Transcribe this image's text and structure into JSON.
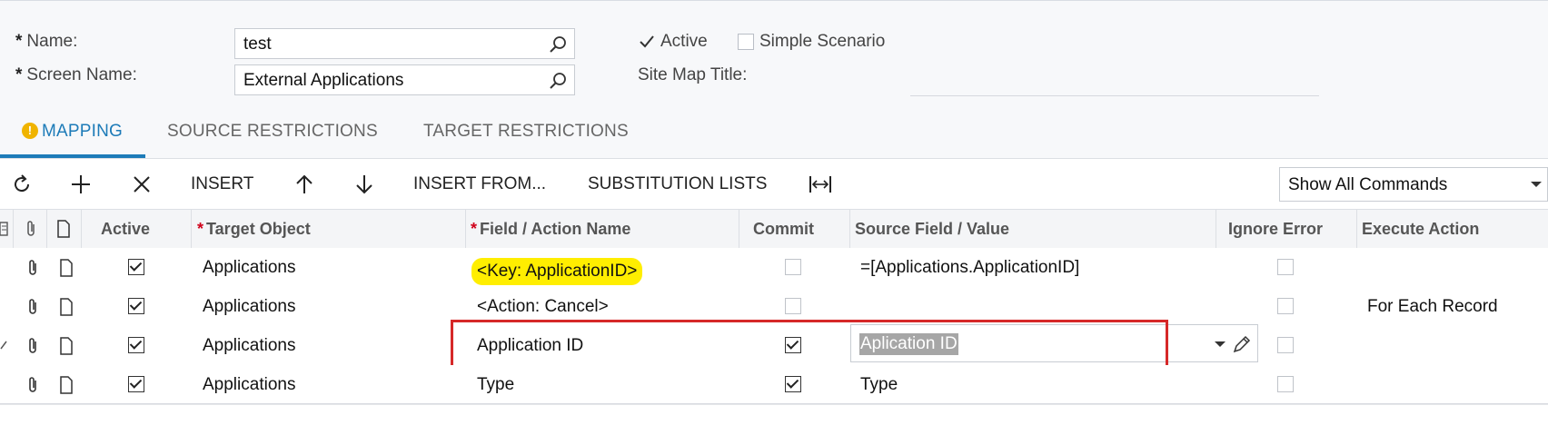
{
  "form": {
    "name_label": "Name:",
    "name_value": "test",
    "screen_name_label": "Screen Name:",
    "screen_name_value": "External Applications",
    "active_label": "Active",
    "active_checked": true,
    "simple_scenario_label": "Simple Scenario",
    "simple_scenario_checked": false,
    "site_map_title_label": "Site Map Title:",
    "site_map_title_value": ""
  },
  "tabs": [
    {
      "label": "MAPPING",
      "active": true,
      "warning": true
    },
    {
      "label": "SOURCE RESTRICTIONS",
      "active": false
    },
    {
      "label": "TARGET RESTRICTIONS",
      "active": false
    }
  ],
  "toolbar": {
    "insert_label": "INSERT",
    "insert_from_label": "INSERT FROM...",
    "substitution_lists_label": "SUBSTITUTION LISTS",
    "commands_select_value": "Show All Commands"
  },
  "grid": {
    "columns": {
      "active": "Active",
      "target_object": "Target Object",
      "field_action_name": "Field / Action Name",
      "commit": "Commit",
      "source_field_value": "Source Field / Value",
      "ignore_error": "Ignore Error",
      "execute_action": "Execute Action"
    },
    "rows": [
      {
        "active": true,
        "target_object": "Applications",
        "field": "<Key: ApplicationID>",
        "commit": false,
        "source": "=[Applications.ApplicationID]",
        "ignore_error": false,
        "execute_action": ""
      },
      {
        "active": true,
        "target_object": "Applications",
        "field": "<Action: Cancel>",
        "commit": false,
        "source": "",
        "ignore_error": false,
        "execute_action": "For Each Record"
      },
      {
        "active": true,
        "target_object": "Applications",
        "field": "Application ID",
        "commit": true,
        "source": "Aplication ID",
        "ignore_error": false,
        "execute_action": ""
      },
      {
        "active": true,
        "target_object": "Applications",
        "field": "Type",
        "commit": true,
        "source": "Type",
        "ignore_error": false,
        "execute_action": ""
      }
    ]
  },
  "colors": {
    "accent": "#1d7bb8",
    "highlight": "#ffee00",
    "annotation_frame": "#d62828",
    "warning": "#f0b400"
  }
}
